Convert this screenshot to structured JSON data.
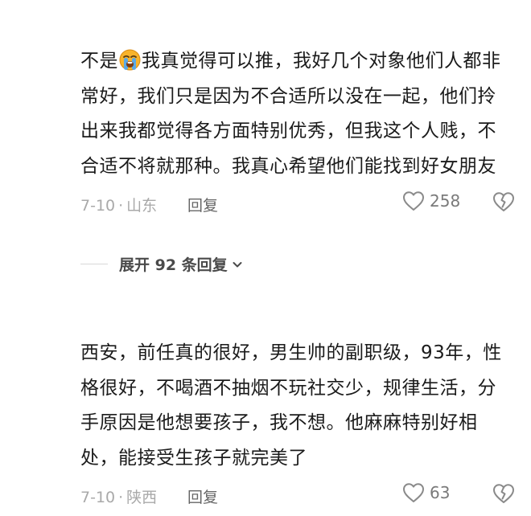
{
  "comments": [
    {
      "text_before_emoji": "不是",
      "emoji": "loudly-crying-face",
      "text_after_emoji": "我真觉得可以推，我好几个对象他们人都非常好，我们只是因为不合适所以没在一起，他们拎出来我都觉得各方面特别优秀，但我这个人贱，不合适不将就那种。我真心希望他们能找到好女朋友",
      "date": "7-10",
      "separator": "·",
      "location": "山东",
      "reply_label": "回复",
      "like_count": "258"
    },
    {
      "text": "西安，前任真的很好，男生帅的副职级，93年，性格很好，不喝酒不抽烟不玩社交少，规律生活，分手原因是他想要孩子，我不想。他麻麻特别好相处，能接受生孩子就完美了",
      "date": "7-10",
      "separator": "·",
      "location": "陕西",
      "reply_label": "回复",
      "like_count": "63"
    }
  ],
  "replies_toggle": {
    "label": "展开 92 条回复"
  },
  "icons": {
    "like": "heart-outline-icon",
    "dislike": "broken-heart-icon",
    "expand": "chevron-down-icon"
  },
  "colors": {
    "text": "#1b1b1b",
    "meta": "#a9a9a9",
    "icon": "#8a8a8a",
    "emoji": "#f7b32b",
    "tears": "#5aa9e6"
  }
}
